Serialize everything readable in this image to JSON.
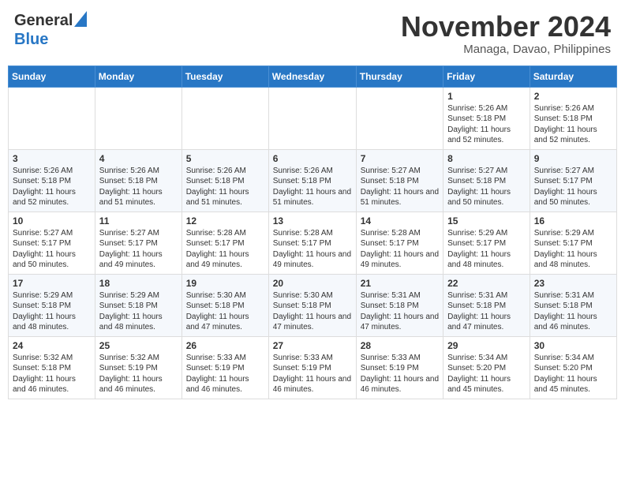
{
  "header": {
    "logo_line1": "General",
    "logo_line2": "Blue",
    "month_title": "November 2024",
    "location": "Managa, Davao, Philippines"
  },
  "weekdays": [
    "Sunday",
    "Monday",
    "Tuesday",
    "Wednesday",
    "Thursday",
    "Friday",
    "Saturday"
  ],
  "weeks": [
    [
      {
        "day": "",
        "sunrise": "",
        "sunset": "",
        "daylight": ""
      },
      {
        "day": "",
        "sunrise": "",
        "sunset": "",
        "daylight": ""
      },
      {
        "day": "",
        "sunrise": "",
        "sunset": "",
        "daylight": ""
      },
      {
        "day": "",
        "sunrise": "",
        "sunset": "",
        "daylight": ""
      },
      {
        "day": "",
        "sunrise": "",
        "sunset": "",
        "daylight": ""
      },
      {
        "day": "1",
        "sunrise": "5:26 AM",
        "sunset": "5:18 PM",
        "daylight": "11 hours and 52 minutes."
      },
      {
        "day": "2",
        "sunrise": "5:26 AM",
        "sunset": "5:18 PM",
        "daylight": "11 hours and 52 minutes."
      }
    ],
    [
      {
        "day": "3",
        "sunrise": "5:26 AM",
        "sunset": "5:18 PM",
        "daylight": "11 hours and 52 minutes."
      },
      {
        "day": "4",
        "sunrise": "5:26 AM",
        "sunset": "5:18 PM",
        "daylight": "11 hours and 51 minutes."
      },
      {
        "day": "5",
        "sunrise": "5:26 AM",
        "sunset": "5:18 PM",
        "daylight": "11 hours and 51 minutes."
      },
      {
        "day": "6",
        "sunrise": "5:26 AM",
        "sunset": "5:18 PM",
        "daylight": "11 hours and 51 minutes."
      },
      {
        "day": "7",
        "sunrise": "5:27 AM",
        "sunset": "5:18 PM",
        "daylight": "11 hours and 51 minutes."
      },
      {
        "day": "8",
        "sunrise": "5:27 AM",
        "sunset": "5:18 PM",
        "daylight": "11 hours and 50 minutes."
      },
      {
        "day": "9",
        "sunrise": "5:27 AM",
        "sunset": "5:17 PM",
        "daylight": "11 hours and 50 minutes."
      }
    ],
    [
      {
        "day": "10",
        "sunrise": "5:27 AM",
        "sunset": "5:17 PM",
        "daylight": "11 hours and 50 minutes."
      },
      {
        "day": "11",
        "sunrise": "5:27 AM",
        "sunset": "5:17 PM",
        "daylight": "11 hours and 49 minutes."
      },
      {
        "day": "12",
        "sunrise": "5:28 AM",
        "sunset": "5:17 PM",
        "daylight": "11 hours and 49 minutes."
      },
      {
        "day": "13",
        "sunrise": "5:28 AM",
        "sunset": "5:17 PM",
        "daylight": "11 hours and 49 minutes."
      },
      {
        "day": "14",
        "sunrise": "5:28 AM",
        "sunset": "5:17 PM",
        "daylight": "11 hours and 49 minutes."
      },
      {
        "day": "15",
        "sunrise": "5:29 AM",
        "sunset": "5:17 PM",
        "daylight": "11 hours and 48 minutes."
      },
      {
        "day": "16",
        "sunrise": "5:29 AM",
        "sunset": "5:17 PM",
        "daylight": "11 hours and 48 minutes."
      }
    ],
    [
      {
        "day": "17",
        "sunrise": "5:29 AM",
        "sunset": "5:18 PM",
        "daylight": "11 hours and 48 minutes."
      },
      {
        "day": "18",
        "sunrise": "5:29 AM",
        "sunset": "5:18 PM",
        "daylight": "11 hours and 48 minutes."
      },
      {
        "day": "19",
        "sunrise": "5:30 AM",
        "sunset": "5:18 PM",
        "daylight": "11 hours and 47 minutes."
      },
      {
        "day": "20",
        "sunrise": "5:30 AM",
        "sunset": "5:18 PM",
        "daylight": "11 hours and 47 minutes."
      },
      {
        "day": "21",
        "sunrise": "5:31 AM",
        "sunset": "5:18 PM",
        "daylight": "11 hours and 47 minutes."
      },
      {
        "day": "22",
        "sunrise": "5:31 AM",
        "sunset": "5:18 PM",
        "daylight": "11 hours and 47 minutes."
      },
      {
        "day": "23",
        "sunrise": "5:31 AM",
        "sunset": "5:18 PM",
        "daylight": "11 hours and 46 minutes."
      }
    ],
    [
      {
        "day": "24",
        "sunrise": "5:32 AM",
        "sunset": "5:18 PM",
        "daylight": "11 hours and 46 minutes."
      },
      {
        "day": "25",
        "sunrise": "5:32 AM",
        "sunset": "5:19 PM",
        "daylight": "11 hours and 46 minutes."
      },
      {
        "day": "26",
        "sunrise": "5:33 AM",
        "sunset": "5:19 PM",
        "daylight": "11 hours and 46 minutes."
      },
      {
        "day": "27",
        "sunrise": "5:33 AM",
        "sunset": "5:19 PM",
        "daylight": "11 hours and 46 minutes."
      },
      {
        "day": "28",
        "sunrise": "5:33 AM",
        "sunset": "5:19 PM",
        "daylight": "11 hours and 46 minutes."
      },
      {
        "day": "29",
        "sunrise": "5:34 AM",
        "sunset": "5:20 PM",
        "daylight": "11 hours and 45 minutes."
      },
      {
        "day": "30",
        "sunrise": "5:34 AM",
        "sunset": "5:20 PM",
        "daylight": "11 hours and 45 minutes."
      }
    ]
  ]
}
